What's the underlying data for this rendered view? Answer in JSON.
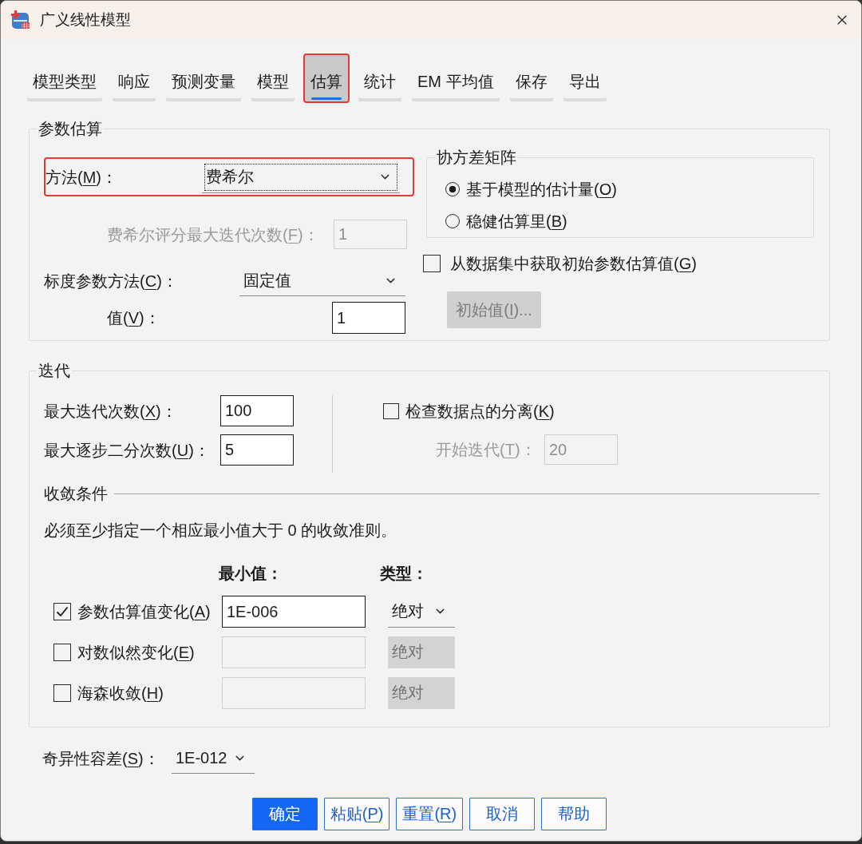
{
  "window": {
    "title": "广义线性模型"
  },
  "tabs": [
    {
      "label": "模型类型",
      "selected": false,
      "highlighted": false
    },
    {
      "label": "响应",
      "selected": false,
      "highlighted": false
    },
    {
      "label": "预测变量",
      "selected": false,
      "highlighted": false
    },
    {
      "label": "模型",
      "selected": false,
      "highlighted": false
    },
    {
      "label": "估算",
      "selected": true,
      "highlighted": true
    },
    {
      "label": "统计",
      "selected": false,
      "highlighted": false
    },
    {
      "label": "EM 平均值",
      "selected": false,
      "highlighted": false
    },
    {
      "label": "保存",
      "selected": false,
      "highlighted": false
    },
    {
      "label": "导出",
      "selected": false,
      "highlighted": false
    }
  ],
  "parameter_estimation": {
    "title": "参数估算",
    "method": {
      "label": {
        "before": "方法(",
        "key": "M",
        "after": ")："
      },
      "value": "费希尔",
      "highlighted": true,
      "focused": true
    },
    "fisher_max_iterations": {
      "label": {
        "before": "费希尔评分最大迭代次数(",
        "key": "F",
        "after": ")："
      },
      "value": "1",
      "disabled": true
    },
    "scale_method": {
      "label": {
        "before": "标度参数方法(",
        "key": "C",
        "after": ")："
      },
      "value": "固定值"
    },
    "scale_value": {
      "label": {
        "before": "值(",
        "key": "V",
        "after": ")："
      },
      "value": "1",
      "disabled": false
    },
    "covariance_matrix": {
      "title": "协方差矩阵",
      "options": [
        {
          "label": {
            "before": "基于模型的估计量(",
            "key": "O",
            "after": ")"
          },
          "selected": true
        },
        {
          "label": {
            "before": "稳健估算里(",
            "key": "B",
            "after": ")"
          },
          "selected": false
        }
      ]
    },
    "initial_from_dataset": {
      "label": {
        "before": "从数据集中获取初始参数估算值(",
        "key": "G",
        "after": ")"
      },
      "checked": false
    },
    "initial_values_button": {
      "label": {
        "before": "初始值(",
        "key": "I",
        "after": ")..."
      },
      "disabled": true
    }
  },
  "iterations": {
    "title": "迭代",
    "max_iterations": {
      "label": {
        "before": "最大迭代次数(",
        "key": "X",
        "after": ")："
      },
      "value": "100",
      "disabled": false
    },
    "max_step_halving": {
      "label": {
        "before": "最大逐步二分次数(",
        "key": "U",
        "after": ")："
      },
      "value": "5",
      "disabled": false
    },
    "check_separation": {
      "label": {
        "before": "检查数据点的分离(",
        "key": "K",
        "after": ")"
      },
      "checked": false
    },
    "start_iteration": {
      "label": {
        "before": "开始迭代(",
        "key": "T",
        "after": ")："
      },
      "value": "20",
      "disabled": true
    },
    "convergence": {
      "title": "收敛条件",
      "note": "必须至少指定一个相应最小值大于 0 的收敛准则。",
      "minimum_header": "最小值：",
      "type_header": "类型：",
      "criteria": [
        {
          "label": {
            "before": "参数估算值变化(",
            "key": "A",
            "after": ")"
          },
          "checked": true,
          "minimum": "1E-006",
          "type": "绝对"
        },
        {
          "label": {
            "before": "对数似然变化(",
            "key": "E",
            "after": ")"
          },
          "checked": false,
          "type": "绝对"
        },
        {
          "label": {
            "before": "海森收敛(",
            "key": "H",
            "after": ")"
          },
          "checked": false,
          "type": "绝对"
        }
      ]
    }
  },
  "singularity_tolerance": {
    "label": {
      "before": "奇异性容差(",
      "key": "S",
      "after": ")："
    },
    "value": "1E-012"
  },
  "buttons": [
    {
      "label": "确定",
      "primary": true
    },
    {
      "label": {
        "before": "粘贴(",
        "key": "P",
        "after": ")"
      },
      "primary": false
    },
    {
      "label": {
        "before": "重置(",
        "key": "R",
        "after": ")"
      },
      "primary": false
    },
    {
      "label": "取消",
      "primary": false
    },
    {
      "label": "帮助",
      "primary": false
    }
  ]
}
